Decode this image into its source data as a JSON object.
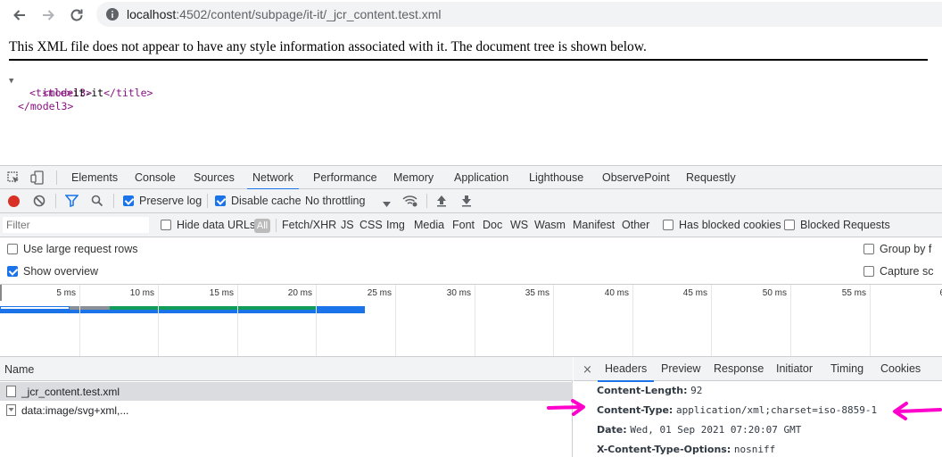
{
  "browser": {
    "url_host": "localhost",
    "url_rest": ":4502/content/subpage/it-it/_jcr_content.test.xml",
    "back_icon": "arrow-left-icon",
    "forward_icon": "arrow-right-icon",
    "reload_icon": "reload-icon",
    "info_icon": "info-icon"
  },
  "xml_viewer": {
    "message": "This XML file does not appear to have any style information associated with it. The document tree is shown below.",
    "lines": {
      "open": "<model3>",
      "title_open": "<title>",
      "title_text": "it-it",
      "title_close": "</title>",
      "close": "</model3>"
    }
  },
  "devtools": {
    "tabs": [
      "Elements",
      "Console",
      "Sources",
      "Network",
      "Performance",
      "Memory",
      "Application",
      "Lighthouse",
      "ObservePoint",
      "Requestly"
    ],
    "active_tab": "Network",
    "toolbar": {
      "preserve_log": "Preserve log",
      "disable_cache": "Disable cache",
      "throttling": "No throttling"
    },
    "filter": {
      "placeholder": "Filter",
      "hide_data_urls": "Hide data URLs",
      "all": "All",
      "types": [
        "Fetch/XHR",
        "JS",
        "CSS",
        "Img",
        "Media",
        "Font",
        "Doc",
        "WS",
        "Wasm",
        "Manifest",
        "Other"
      ],
      "has_blocked_cookies": "Has blocked cookies",
      "blocked_requests": "Blocked Requests"
    },
    "options": {
      "large_rows": "Use large request rows",
      "show_overview": "Show overview",
      "group_by": "Group by f",
      "capture": "Capture sc"
    },
    "overview": {
      "ticks": [
        "5 ms",
        "10 ms",
        "15 ms",
        "20 ms",
        "25 ms",
        "30 ms",
        "35 ms",
        "40 ms",
        "45 ms",
        "50 ms",
        "55 ms",
        "6"
      ],
      "colors": {
        "waiting": "#5f6b7a",
        "download": "#1a73e8",
        "green": "#11998e"
      }
    },
    "requests": {
      "header": "Name",
      "rows": [
        "_jcr_content.test.xml",
        "data:image/svg+xml,..."
      ]
    },
    "detail": {
      "tabs": [
        "Headers",
        "Preview",
        "Response",
        "Initiator",
        "Timing",
        "Cookies"
      ],
      "active_tab": "Headers",
      "headers": [
        {
          "key": "Content-Length:",
          "value": "92"
        },
        {
          "key": "Content-Type:",
          "value": "application/xml;charset=iso-8859-1"
        },
        {
          "key": "Date:",
          "value": "Wed, 01 Sep 2021 07:20:07 GMT"
        },
        {
          "key": "X-Content-Type-Options:",
          "value": "nosniff"
        }
      ]
    },
    "annotation_color": "#ff00cc"
  }
}
